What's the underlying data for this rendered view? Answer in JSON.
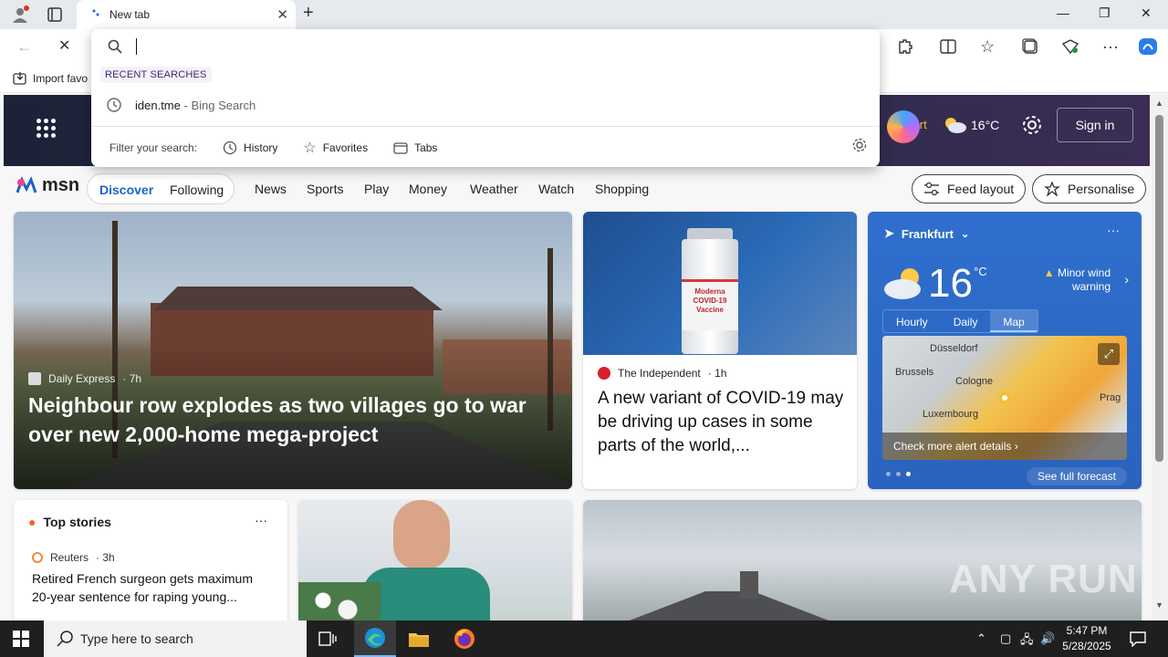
{
  "browser": {
    "tab_title": "New tab",
    "fav_import_label": "Import favo",
    "window_controls": {
      "minimize": "—",
      "restore": "❐",
      "close": "✕"
    }
  },
  "search_dropdown": {
    "recent_header": "RECENT SEARCHES",
    "suggestion_query": "iden.tme",
    "suggestion_source": "- Bing Search",
    "filter_label": "Filter your search:",
    "filters": [
      "History",
      "Favorites",
      "Tabs"
    ]
  },
  "msn_header": {
    "location_partial": "ankfurt",
    "temperature": "16°C",
    "sign_in": "Sign in"
  },
  "nav": {
    "logo_text": "msn",
    "pill": [
      "Discover",
      "Following"
    ],
    "links": [
      "News",
      "Sports",
      "Play",
      "Money",
      "Weather",
      "Watch",
      "Shopping"
    ],
    "feed_layout": "Feed layout",
    "personalise": "Personalise"
  },
  "hero": {
    "source": "Daily Express",
    "age": "· 7h",
    "headline": "Neighbour row explodes as two villages go to war over new 2,000-home mega-project"
  },
  "covid": {
    "source": "The Independent",
    "age": "· 1h",
    "headline": "A new variant of COVID-19 may be driving up cases in some parts of the world,...",
    "vial_label": "Moderna COVID-19 Vaccine"
  },
  "weather": {
    "location": "Frankfurt",
    "temp": "16",
    "unit": "°C",
    "warning_line1": "Minor wind",
    "warning_line2": "warning",
    "tabs": [
      "Hourly",
      "Daily",
      "Map"
    ],
    "map_cities": [
      "Düsseldorf",
      "Brussels",
      "Cologne",
      "Luxembourg",
      "Prag"
    ],
    "alert_link": "Check more alert details ›",
    "forecast": "See full forecast"
  },
  "top_stories": {
    "title": "Top stories",
    "source": "Reuters",
    "age": "· 3h",
    "headline": "Retired French surgeon gets maximum 20-year sentence for raping young..."
  },
  "watermark": "ANY RUN",
  "taskbar": {
    "search_placeholder": "Type here to search",
    "time": "5:47 PM",
    "date": "5/28/2025"
  },
  "colors": {
    "accent_blue": "#1a63c9",
    "weather_bg": "#2f6fce",
    "msn_header_bg": "#2c2a48"
  }
}
